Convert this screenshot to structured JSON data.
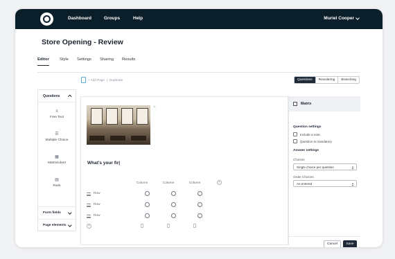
{
  "topbar": {
    "nav": [
      "Dashboard",
      "Groups",
      "Help"
    ],
    "user": "Muriel Cooper"
  },
  "page_title": "Store Opening - Review",
  "tabs": [
    "Editor",
    "Style",
    "Settings",
    "Sharing",
    "Results"
  ],
  "breadcrumb": {
    "page": "+ Add Page",
    "action": "Duplicate"
  },
  "view_toggle": [
    "Questions",
    "Reordering",
    "Branching"
  ],
  "left_panel": {
    "header": "Questions",
    "items": [
      {
        "label": "Free Text",
        "icon": "free-text-icon",
        "glyph": "≡"
      },
      {
        "label": "Multiple Choice",
        "icon": "multiple-choice-icon",
        "glyph": "☰"
      },
      {
        "label": "Matrix/Likert",
        "icon": "matrix-icon",
        "glyph": "▦"
      },
      {
        "label": "Rank",
        "icon": "rank-icon",
        "glyph": "▤"
      }
    ],
    "form_fields": "Form fields",
    "page_elements": "Page elements"
  },
  "question": {
    "text": "What's your fir|",
    "columns": [
      "Column",
      "Column",
      "Column"
    ],
    "rows": [
      "Row",
      "Row",
      "Row"
    ],
    "add_symbol": "+"
  },
  "right_panel": {
    "header": "Matrix",
    "question_settings": "Question settings",
    "options": [
      "Include a note",
      "Question is mandatory"
    ],
    "answer_settings": "Answer settings",
    "choices_label": "Choices",
    "choices_value": "Single choice per question",
    "order_label": "Order Choices",
    "order_value": "As entered",
    "cancel": "Cancel",
    "save": "Save"
  },
  "colors": {
    "topbar": "#0b1f2a",
    "primary_button": "#1e2a38",
    "accent": "#5aa7d6"
  }
}
